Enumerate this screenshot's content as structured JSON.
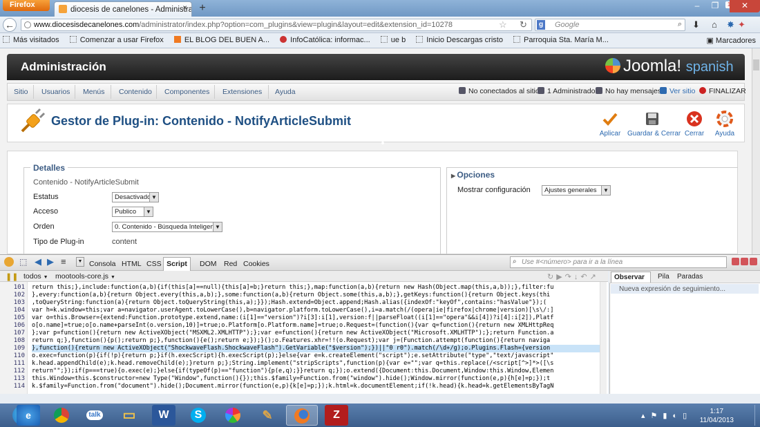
{
  "browser": {
    "menu_button": "Firefox",
    "tab_title": "diocesis de canelones - Administración",
    "url_domain": "www.diocesisdecanelones.com",
    "url_path": "/administrator/index.php?option=com_plugins&view=plugin&layout=edit&extension_id=10278",
    "search_placeholder": "Google",
    "notification_badge": "1"
  },
  "bookmarks": {
    "items": [
      {
        "label": "Más visitados",
        "icon": "gear-icon"
      },
      {
        "label": "Comenzar a usar Firefox",
        "icon": "page-icon"
      },
      {
        "label": "EL BLOG DEL BUEN A...",
        "icon": "blogger-icon"
      },
      {
        "label": "InfoCatólica: informac...",
        "icon": "site-icon"
      },
      {
        "label": "ue b",
        "icon": "page-icon"
      },
      {
        "label": "Inicio Descargas cristo",
        "icon": "page-icon"
      },
      {
        "label": "Parroquia Sta. María M...",
        "icon": "page-icon"
      }
    ],
    "right_label": "Marcadores"
  },
  "admin": {
    "title": "Administración",
    "logo_text": "Joomla!",
    "logo_suffix": "spanish",
    "menu": [
      "Sitio",
      "Usuarios",
      "Menús",
      "Contenido",
      "Componentes",
      "Extensiones",
      "Ayuda"
    ],
    "status": {
      "site": "No conectados al sitio",
      "admins": "1 Administrador",
      "messages": "No hay mensajes",
      "view_site": "Ver sitio",
      "logout": "FINALIZAR"
    }
  },
  "header": {
    "title": "Gestor de Plug-in: Contenido - NotifyArticleSubmit",
    "buttons": {
      "apply": "Aplicar",
      "save_close": "Guardar & Cerrar",
      "close": "Cerrar",
      "help": "Ayuda"
    }
  },
  "details": {
    "legend": "Detalles",
    "plugin_name": "Contenido - NotifyArticleSubmit",
    "estado_label": "Estatus",
    "estado_value": "Desactivado",
    "acceso_label": "Acceso",
    "acceso_value": "Publico",
    "orden_label": "Orden",
    "orden_value": "0. Contenido - Búsqueda Inteligen...",
    "tipo_label": "Tipo de Plug-in",
    "tipo_value": "content"
  },
  "options": {
    "title": "Opciones",
    "show_config_label": "Mostrar configuración",
    "show_config_value": "Ajustes generales"
  },
  "firebug": {
    "tabs": [
      "Consola",
      "HTML",
      "CSS",
      "Script",
      "DOM",
      "Red",
      "Cookies"
    ],
    "active_tab": "Script",
    "search_placeholder": "Use #<número> para ir a la línea",
    "filter": "todos",
    "file": "mootools-core.js",
    "watch_tabs": [
      "Observar",
      "Pila",
      "Paradas"
    ],
    "watch_placeholder": "Nueva expresión de seguimiento...",
    "code_lines": [
      {
        "n": "101",
        "t": "return this;},include:function(a,b){if(this[a]==null){this[a]=b;}return this;},map:function(a,b){return new Hash(Object.map(this,a,b));},filter:fu"
      },
      {
        "n": "102",
        "t": "},every:function(a,b){return Object.every(this,a,b);},some:function(a,b){return Object.some(this,a,b);},getKeys:function(){return Object.keys(thi"
      },
      {
        "n": "103",
        "t": ",toQueryString:function(a){return Object.toQueryString(this,a);}});Hash.extend=Object.append;Hash.alias({indexOf:\"keyOf\",contains:\"hasValue\"});("
      },
      {
        "n": "104",
        "t": "var h=k.window=this;var a=navigator.userAgent.toLowerCase(),b=navigator.platform.toLowerCase(),i=a.match(/(opera|ie|firefox|chrome|version)[\\s\\/:]"
      },
      {
        "n": "105",
        "t": "var o=this.Browser={extend:Function.prototype.extend,name:(i[1]==\"version\")?i[3]:i[1],version:f||parseFloat((i[1]==\"opera\"&&i[4])?i[4]:i[2]),Platf"
      },
      {
        "n": "106",
        "t": "o[o.name]=true;o[o.name+parseInt(o.version,10)]=true;o.Platform[o.Platform.name]=true;o.Request=(function(){var q=function(){return new XMLHttpReq"
      },
      {
        "n": "107",
        "t": "};var p=function(){return new ActiveXObject(\"MSXML2.XMLHTTP\");};var e=function(){return new ActiveXObject(\"Microsoft.XMLHTTP\");};return Function.a"
      },
      {
        "n": "108",
        "t": "return q;},function(){p();return p;},function(){e();return e;});}();o.Features.xhr=!!(o.Request);var j=(Function.attempt(function(){return naviga"
      },
      {
        "n": "109",
        "t": "},function(){return new ActiveXObject(\"ShockwaveFlash.ShockwaveFlash\").GetVariable(\"$version\");})||\"0 r0\").match(/\\d+/g);o.Plugins.Flash={version"
      },
      {
        "n": "110",
        "t": "o.exec=function(p){if(!p){return p;}if(h.execScript){h.execScript(p);}else{var e=k.createElement(\"script\");e.setAttribute(\"type\",\"text/javascript\""
      },
      {
        "n": "111",
        "t": "k.head.appendChild(e);k.head.removeChild(e);}return p;};String.implement(\"stripScripts\",function(p){var e=\"\";var q=this.replace(/<script[^>]*>([\\s"
      },
      {
        "n": "112",
        "t": "return\"\";});if(p===true){o.exec(e);}else{if(typeOf(p)==\"function\"){p(e,q);}}return q;});o.extend({Document:this.Document,Window:this.Window,Elemen"
      },
      {
        "n": "113",
        "t": "this.Window=this.$constructor=new Type(\"Window\",function(){});this.$family=Function.from(\"window\").hide();Window.mirror(function(e,p){h[e]=p;});t"
      },
      {
        "n": "114",
        "t": "k.$family=Function.from(\"document\").hide();Document.mirror(function(e,p){k[e]=p;});k.html=k.documentElement;if(!k.head){k.head=k.getElementsByTagN"
      }
    ],
    "highlight_line": "109"
  },
  "taskbar": {
    "apps": [
      "Internet Explorer",
      "Chrome",
      "Google Talk",
      "Explorador",
      "Word",
      "Skype",
      "Picasa",
      "Paint",
      "Firefox",
      "FileZilla"
    ],
    "active_app": "Firefox",
    "time": "1:17",
    "date": "11/04/2013"
  }
}
